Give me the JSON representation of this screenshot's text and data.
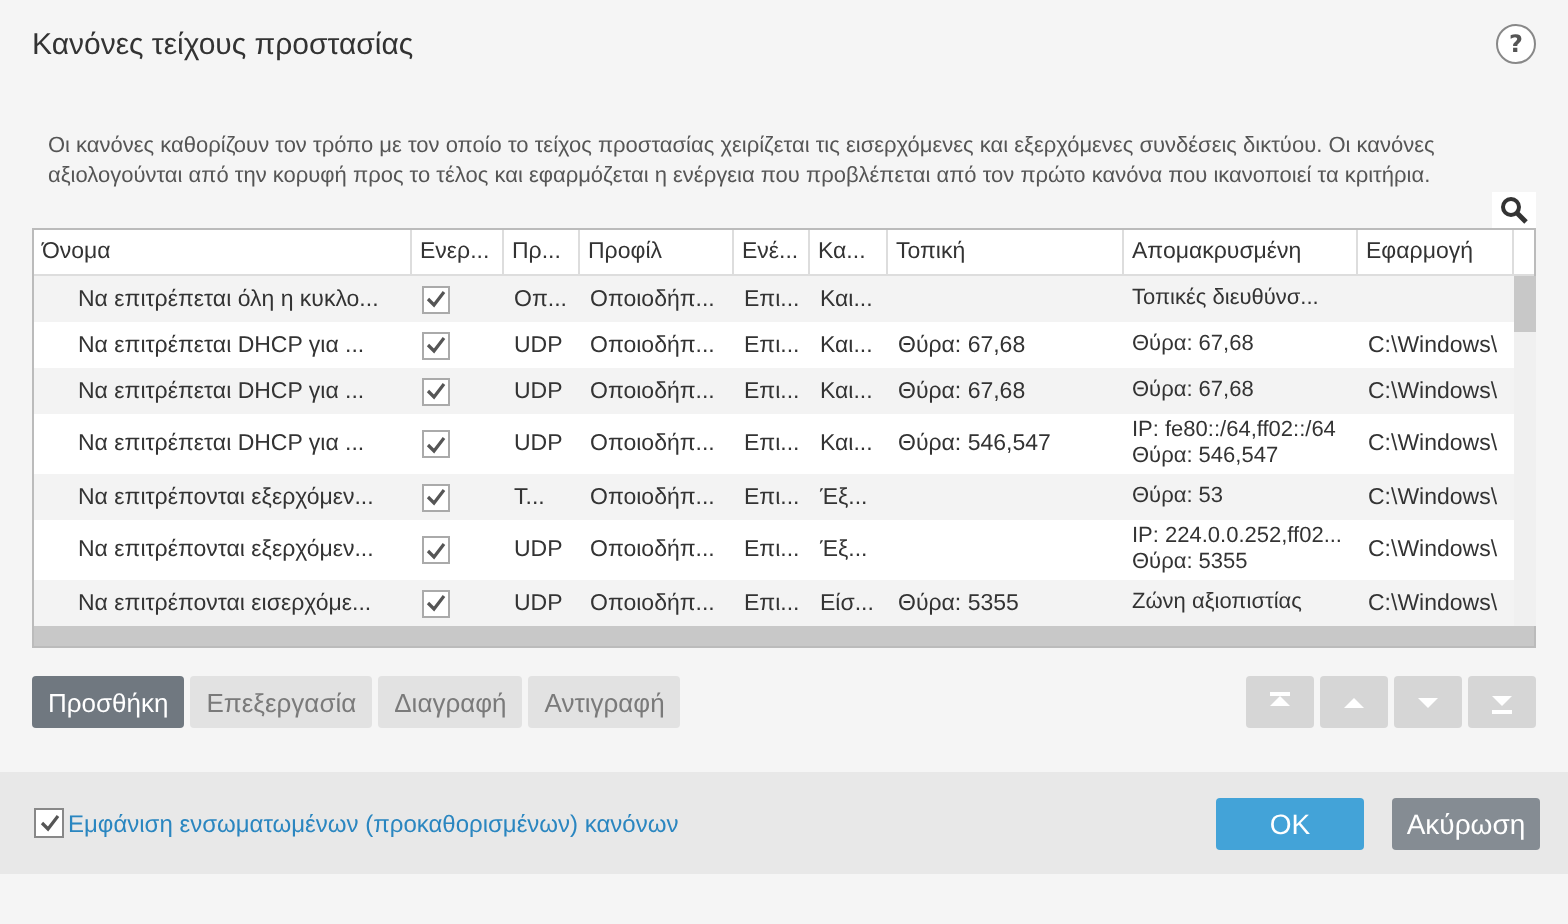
{
  "window": {
    "title": "Κανόνες τείχους προστασίας",
    "help": "?"
  },
  "description": "Οι κανόνες καθορίζουν τον τρόπο με τον οποίο το τείχος προστασίας χειρίζεται τις εισερχόμενες και εξερχόμενες συνδέσεις δικτύου. Οι κανόνες αξιολογούνται από την κορυφή προς το τέλος και εφαρμόζεται η ενέργεια που προβλέπεται από τον πρώτο κανόνα που ικανοποιεί τα κριτήρια.",
  "table": {
    "columns": [
      "Όνομα",
      "Ενερ...",
      "Πρ...",
      "Προφίλ",
      "Ενέ...",
      "Κα...",
      "Τοπική",
      "Απομακρυσμένη",
      "Εφαρμογή"
    ],
    "rows": [
      {
        "name": "Να επιτρέπεται όλη η κυκλο...",
        "enabled": true,
        "protocol": "Οπ...",
        "profile": "Οποιοδήπ...",
        "action": "Επι...",
        "direction": "Και...",
        "remote": [
          "Τοπικές διευθύνσ..."
        ]
      },
      {
        "name": "Να επιτρέπεται DHCP για ...",
        "enabled": true,
        "protocol": "UDP",
        "profile": "Οποιοδήπ...",
        "action": "Επι...",
        "direction": "Και...",
        "local": "Θύρα: 67,68",
        "remote": [
          "Θύρα: 67,68"
        ],
        "application": "C:\\Windows\\"
      },
      {
        "name": "Να επιτρέπεται DHCP για ...",
        "enabled": true,
        "protocol": "UDP",
        "profile": "Οποιοδήπ...",
        "action": "Επι...",
        "direction": "Και...",
        "local": "Θύρα: 67,68",
        "remote": [
          "Θύρα: 67,68"
        ],
        "application": "C:\\Windows\\"
      },
      {
        "name": "Να επιτρέπεται DHCP για ...",
        "enabled": true,
        "protocol": "UDP",
        "profile": "Οποιοδήπ...",
        "action": "Επι...",
        "direction": "Και...",
        "local": "Θύρα: 546,547",
        "remote": [
          "IP: fe80::/64,ff02::/64",
          "Θύρα: 546,547"
        ],
        "application": "C:\\Windows\\"
      },
      {
        "name": "Να επιτρέπονται εξερχόμεν...",
        "enabled": true,
        "protocol": "T...",
        "profile": "Οποιοδήπ...",
        "action": "Επι...",
        "direction": "Έξ...",
        "remote": [
          "Θύρα: 53"
        ],
        "application": "C:\\Windows\\"
      },
      {
        "name": "Να επιτρέπονται εξερχόμεν...",
        "enabled": true,
        "protocol": "UDP",
        "profile": "Οποιοδήπ...",
        "action": "Επι...",
        "direction": "Έξ...",
        "remote": [
          "IP: 224.0.0.252,ff02...",
          "Θύρα: 5355"
        ],
        "application": "C:\\Windows\\"
      },
      {
        "name": "Να επιτρέπονται εισερχόμε...",
        "enabled": true,
        "protocol": "UDP",
        "profile": "Οποιοδήπ...",
        "action": "Επι...",
        "direction": "Είσ...",
        "local": "Θύρα: 5355",
        "remote": [
          "Ζώνη αξιοπιστίας"
        ],
        "application": "C:\\Windows\\"
      }
    ]
  },
  "actions": [
    {
      "label": "Προσθήκη",
      "disabled": false
    },
    {
      "label": "Επεξεργασία",
      "disabled": true
    },
    {
      "label": "Διαγραφή",
      "disabled": true
    },
    {
      "label": "Αντιγραφή",
      "disabled": true
    }
  ],
  "move_buttons": [
    {
      "kind": "top",
      "disabled": true
    },
    {
      "kind": "up",
      "disabled": true
    },
    {
      "kind": "down",
      "disabled": true
    },
    {
      "kind": "bottom",
      "disabled": true
    }
  ],
  "show_builtin": {
    "label": "Εμφάνιση ενσωματωμένων (προκαθορισμένων) κανόνων",
    "checked": true
  },
  "buttons": [
    {
      "label": "OK",
      "kind": "primary"
    },
    {
      "label": "Ακύρωση",
      "kind": "secondary"
    }
  ]
}
